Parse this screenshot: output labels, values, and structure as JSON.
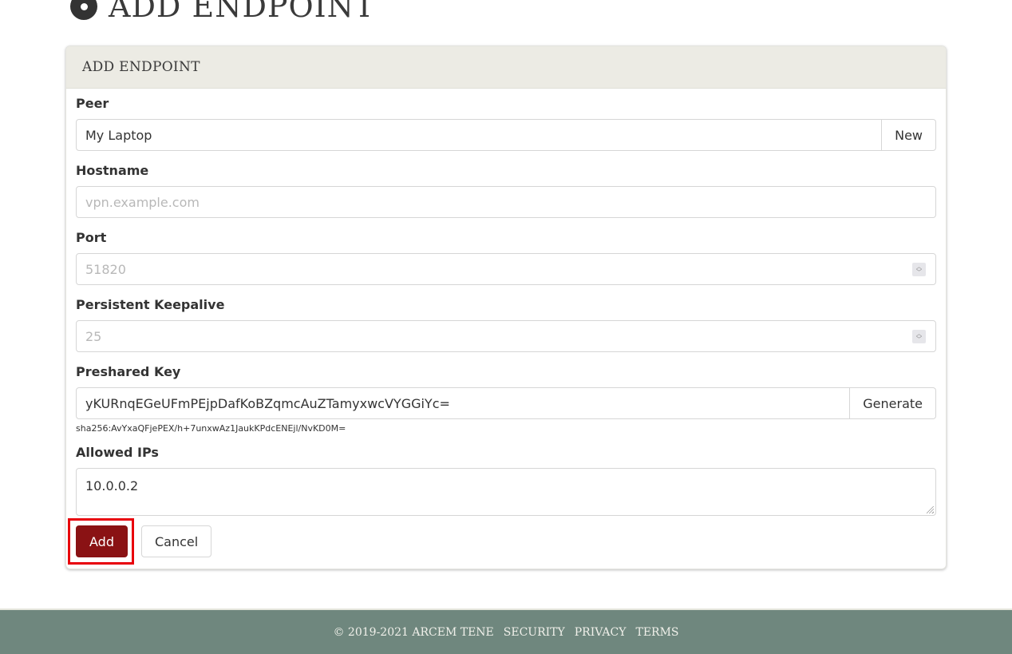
{
  "page": {
    "title": "ADD ENDPOINT",
    "title_icon": "disc-icon"
  },
  "card": {
    "header": "ADD ENDPOINT",
    "fields": {
      "peer": {
        "label": "Peer",
        "value": "My Laptop",
        "button": "New"
      },
      "hostname": {
        "label": "Hostname",
        "value": "",
        "placeholder": "vpn.example.com"
      },
      "port": {
        "label": "Port",
        "value": "",
        "placeholder": "51820"
      },
      "keepalive": {
        "label": "Persistent Keepalive",
        "value": "",
        "placeholder": "25"
      },
      "preshared_key": {
        "label": "Preshared Key",
        "value": "yKURnqEGeUFmPEjpDafKoBZqmcAuZTamyxwcVYGGiYc=",
        "button": "Generate",
        "hint": "sha256:AvYxaQFjePEX/h+7unxwAz1JaukKPdcENEjl/NvKD0M="
      },
      "allowed_ips": {
        "label": "Allowed IPs",
        "value": "10.0.0.2"
      }
    },
    "actions": {
      "add": "Add",
      "cancel": "Cancel"
    },
    "highlight_color": "#e8000b",
    "primary_color": "#8a1214"
  },
  "footer": {
    "copyright": "© 2019-2021 ARCEM TENE",
    "links": [
      "SECURITY",
      "PRIVACY",
      "TERMS"
    ]
  }
}
